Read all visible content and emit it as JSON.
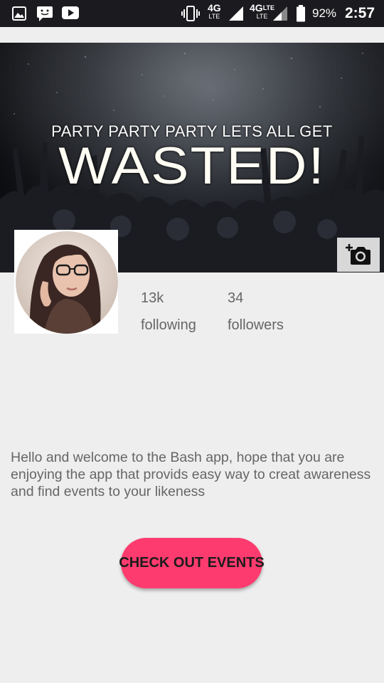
{
  "status_bar": {
    "icons": [
      "image-icon",
      "message-icon",
      "youtube-icon",
      "vibrate-icon",
      "signal-icon",
      "battery-icon"
    ],
    "net1_top": "4G",
    "net1_bottom": "LTE",
    "net2_top": "4G",
    "net2_sup": "LTE",
    "net2_bottom": "LTE",
    "battery": "92%",
    "time": "2:57"
  },
  "cover": {
    "line1": "PARTY PARTY PARTY LETS ALL GET",
    "line2": "WASTED!"
  },
  "profile": {
    "following_count": "13k",
    "following_label": "following",
    "followers_count": "34",
    "followers_label": "followers",
    "bio": "Hello and welcome to the Bash app, hope that you are enjoying the app that  provids easy way to creat awareness and find events to your likeness"
  },
  "actions": {
    "events_button": "CHECK OUT EVENTS"
  },
  "colors": {
    "accent": "#fe3b6e",
    "background": "#eeeeee",
    "status_bar": "#1b1b1f"
  }
}
